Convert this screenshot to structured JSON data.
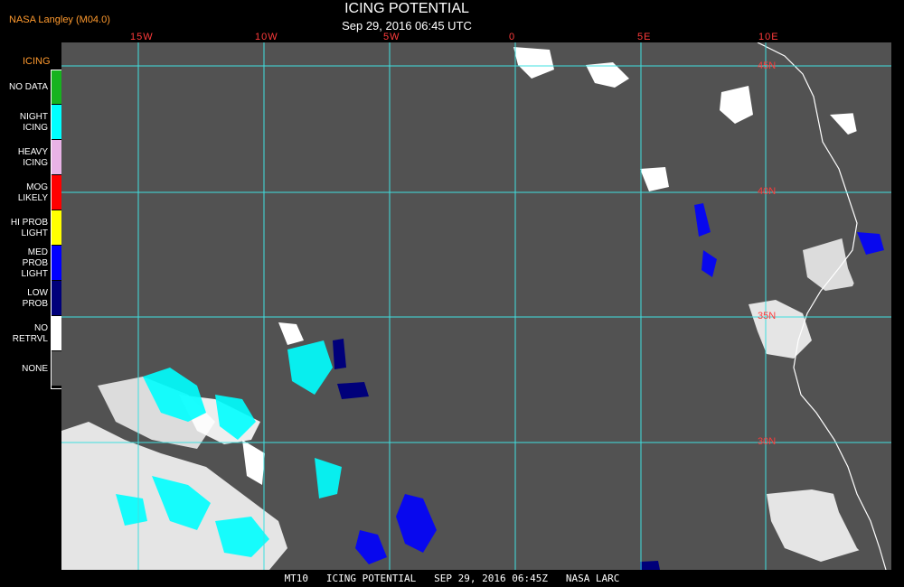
{
  "header": {
    "credit": "NASA Langley (M04.0)",
    "title": "ICING POTENTIAL",
    "subtitle": "Sep 29, 2016 06:45 UTC"
  },
  "legend": {
    "title": "ICING",
    "items": [
      {
        "label": "NO DATA",
        "color": "#17b31f"
      },
      {
        "label": "NIGHT\nICING",
        "color": "#00ffff"
      },
      {
        "label": "HEAVY\nICING",
        "color": "#e8b3e6"
      },
      {
        "label": "MOG\nLIKELY",
        "color": "#ff0000"
      },
      {
        "label": "HI PROB\nLIGHT",
        "color": "#ffff00"
      },
      {
        "label": "MED PROB\nLIGHT",
        "color": "#0000ff"
      },
      {
        "label": "LOW\nPROB",
        "color": "#00007a"
      },
      {
        "label": "NO\nRETRVL",
        "color": "#ffffff"
      },
      {
        "label": "NONE",
        "color": "#525252"
      }
    ]
  },
  "map": {
    "longitude_labels": [
      "15W",
      "10W",
      "5W",
      "0",
      "5E",
      "10E"
    ],
    "latitude_labels": [
      "45N",
      "40N",
      "35N",
      "30N"
    ],
    "background_color": "#525252",
    "grid_color": "#40e0e0",
    "coastline_color": "#ffffff"
  },
  "footer": "MT10   ICING POTENTIAL   SEP 29, 2016 06:45Z   NASA LARC"
}
